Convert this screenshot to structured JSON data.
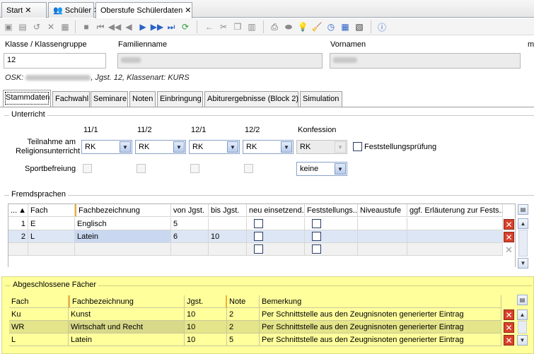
{
  "tabs": [
    {
      "label": "Start",
      "icon": "none"
    },
    {
      "label": "Schüler",
      "icon": "people-icon"
    },
    {
      "label": "Oberstufe Schülerdaten",
      "icon": "none"
    }
  ],
  "header": {
    "klasse_label": "Klasse / Klassengruppe",
    "klasse_value": "12",
    "familienname_label": "Familienname",
    "vornamen_label": "Vornamen",
    "cut_label": "m",
    "osk_prefix": "OSK:",
    "osk_suffix": ", Jgst. 12, Klassenart: KURS"
  },
  "subtabs": [
    "Stammdaten",
    "Fachwahl",
    "Seminare",
    "Noten",
    "Einbringung",
    "Abiturergebnisse (Block 2)",
    "Simulation"
  ],
  "unterricht": {
    "title": "Unterricht",
    "columns": [
      "11/1",
      "11/2",
      "12/1",
      "12/2",
      "Konfession"
    ],
    "religion_label_line1": "Teilnahme am",
    "religion_label_line2": "Religionsunterricht",
    "religion_values": [
      "RK",
      "RK",
      "RK",
      "RK",
      "RK"
    ],
    "feststellung_label": "Feststellungsprüfung",
    "sport_label": "Sportbefreiung",
    "konfession2": "keine"
  },
  "fremdsprachen": {
    "title": "Fremdsprachen",
    "headers": [
      "...",
      "Fach",
      "Fachbezeichnung",
      "von Jgst.",
      "bis Jgst.",
      "neu einsetzend...",
      "Feststellungs...",
      "Niveaustufe",
      "ggf. Erläuterung zur Fests..."
    ],
    "rows": [
      {
        "nr": "1",
        "fach": "E",
        "bez": "Englisch",
        "von": "5",
        "bis": ""
      },
      {
        "nr": "2",
        "fach": "L",
        "bez": "Latein",
        "von": "6",
        "bis": "10"
      }
    ]
  },
  "abgeschlossen": {
    "title": "Abgeschlossene Fächer",
    "headers": [
      "Fach",
      "Fachbezeichnung",
      "Jgst.",
      "Note",
      "Bemerkung"
    ],
    "rows": [
      {
        "fach": "Ku",
        "bez": "Kunst",
        "jgst": "10",
        "note": "2",
        "bem": "Per Schnittstelle aus den Zeugnisnoten generierter Eintrag"
      },
      {
        "fach": "WR",
        "bez": "Wirtschaft und Recht",
        "jgst": "10",
        "note": "2",
        "bem": "Per Schnittstelle aus den Zeugnisnoten generierter Eintrag"
      },
      {
        "fach": "L",
        "bez": "Latein",
        "jgst": "10",
        "note": "5",
        "bem": "Per Schnittstelle aus den Zeugnisnoten generierter Eintrag"
      }
    ]
  }
}
